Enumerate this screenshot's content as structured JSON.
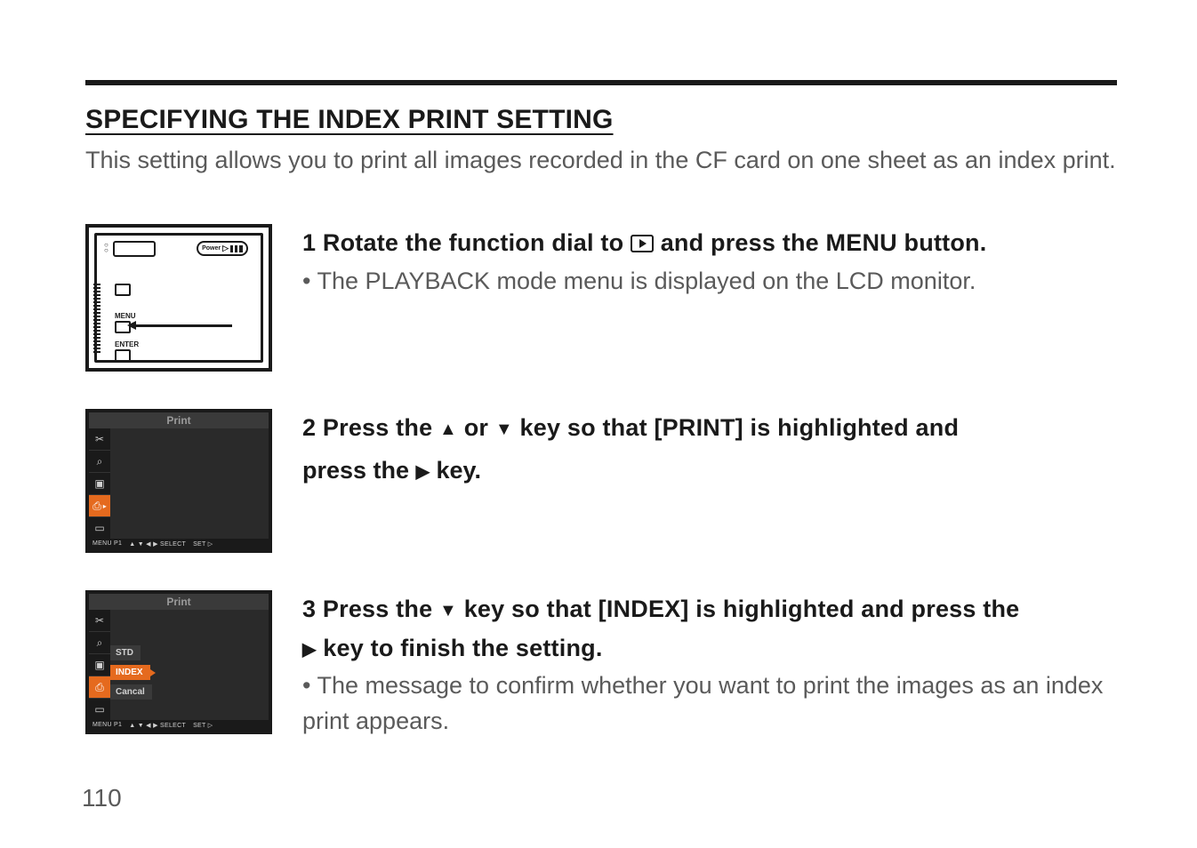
{
  "page": {
    "number": "110"
  },
  "section": {
    "heading": "SPECIFYING THE INDEX PRINT SETTING",
    "intro": "This setting allows you to print all images recorded in the CF card on one sheet as an index print."
  },
  "steps": {
    "s1": {
      "heading_before": "1 Rotate the function dial to ",
      "heading_after": " and press the MENU button.",
      "desc": "• The PLAYBACK mode menu is displayed on the LCD monitor."
    },
    "s2": {
      "heading_before": "2 Press the ",
      "heading_mid": " or ",
      "heading_after": " key so that [PRINT] is highlighted and",
      "heading_line2_before": "press the ",
      "heading_line2_after": " key."
    },
    "s3": {
      "heading_before": "3 Press the ",
      "heading_after": " key so that [INDEX] is highlighted and press the",
      "heading_line2_after": " key to finish the setting.",
      "desc": "• The message to confirm whether you want to print the images as an index print appears."
    }
  },
  "lcd": {
    "title": "Print",
    "foot_menu": "MENU P1",
    "foot_select": "▲ ▼ ◀ ▶ SELECT",
    "foot_set": "SET ▷",
    "opts": {
      "std": "STD",
      "index": "INDEX",
      "cancel": "Cancal"
    }
  },
  "camera": {
    "power": "Power",
    "menu": "MENU",
    "enter": "ENTER"
  },
  "icons": {
    "playback": "▷",
    "up": "▲",
    "down": "▼",
    "right": "▶"
  }
}
